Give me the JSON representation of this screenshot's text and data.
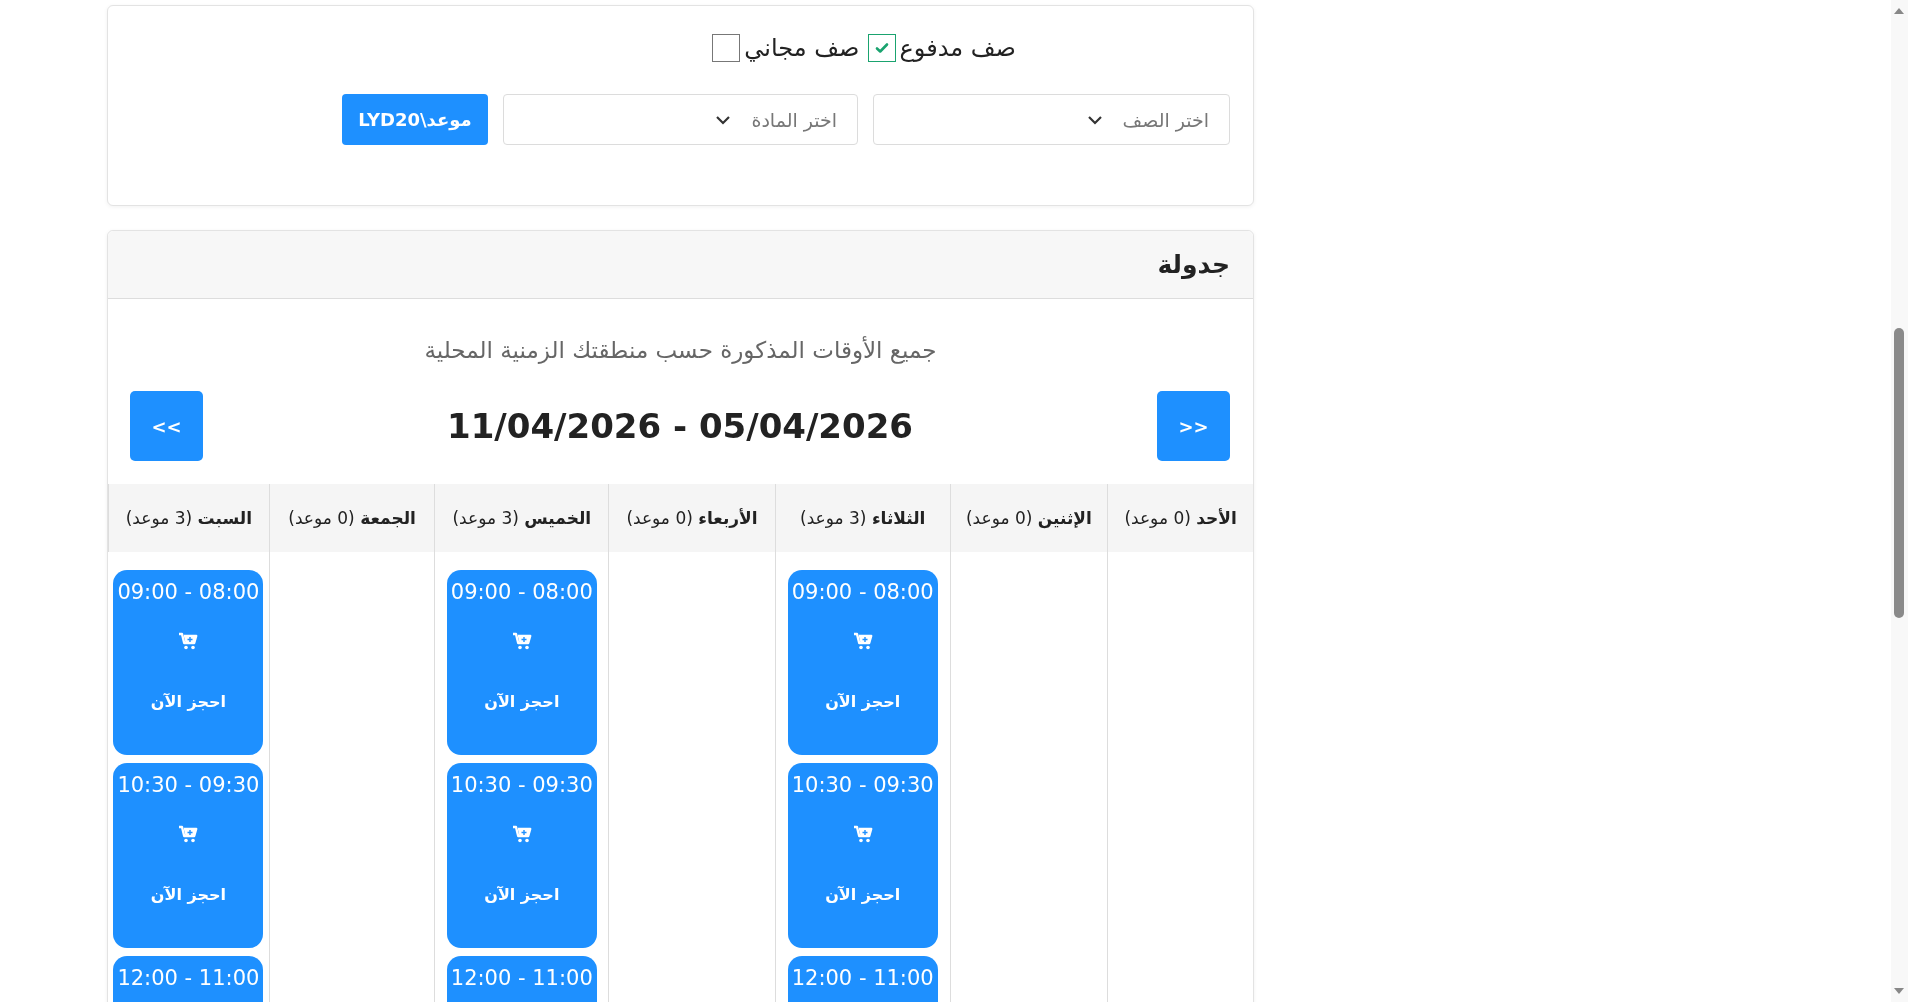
{
  "filters": {
    "options": [
      {
        "label": "صف مدفوع",
        "checked": true
      },
      {
        "label": "صف مجاني",
        "checked": false
      }
    ],
    "class_select": {
      "placeholder": "اختر الصف"
    },
    "subject_select": {
      "placeholder": "اختر المادة"
    },
    "price_button": "موعد\\LYD20"
  },
  "schedule": {
    "title": "جدولة",
    "note": "جميع الأوقات المذكورة حسب منطقتك الزمنية المحلية",
    "next_button": ">>",
    "date_range": "11/04/2026 - 05/04/2026",
    "prev_button": "<<",
    "days": [
      {
        "name": "الأحد",
        "count": "(0 موعد)"
      },
      {
        "name": "الإثنين",
        "count": "(0 موعد)"
      },
      {
        "name": "الثلاثاء",
        "count": "(3 موعد)",
        "slots": [
          {
            "time": "09:00 - 08:00",
            "action": "احجز الآن"
          },
          {
            "time": "10:30 - 09:30",
            "action": "احجز الآن"
          },
          {
            "time": "12:00 - 11:00"
          }
        ]
      },
      {
        "name": "الأربعاء",
        "count": "(0 موعد)"
      },
      {
        "name": "الخميس",
        "count": "(3 موعد)",
        "slots": [
          {
            "time": "09:00 - 08:00",
            "action": "احجز الآن"
          },
          {
            "time": "10:30 - 09:30",
            "action": "احجز الآن"
          },
          {
            "time": "12:00 - 11:00"
          }
        ]
      },
      {
        "name": "الجمعة",
        "count": "(0 موعد)"
      },
      {
        "name": "السبت",
        "count": "(3 موعد)",
        "slots": [
          {
            "time": "09:00 - 08:00",
            "action": "احجز الآن"
          },
          {
            "time": "10:30 - 09:30",
            "action": "احجز الآن"
          },
          {
            "time": "12:00 - 11:00"
          }
        ]
      }
    ]
  }
}
